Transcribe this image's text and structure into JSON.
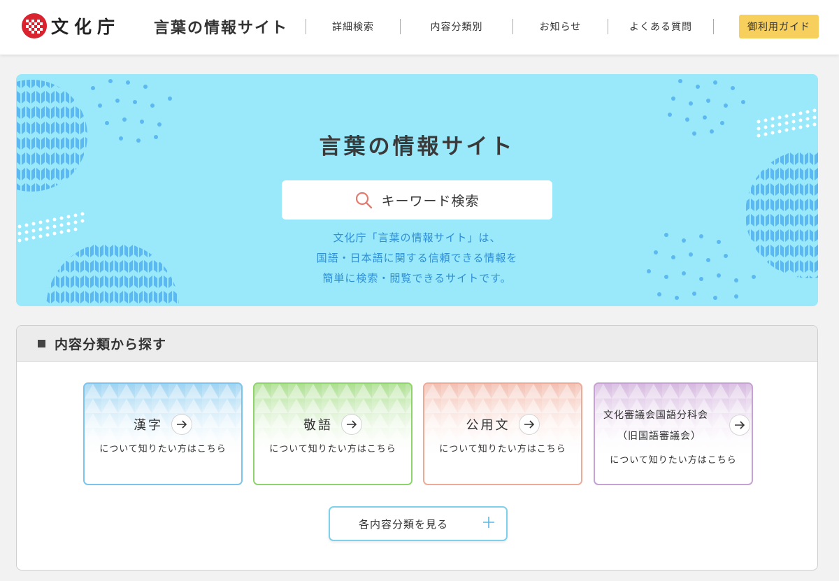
{
  "header": {
    "logo_text": "文化庁",
    "site_title": "言葉の情報サイト",
    "nav": [
      {
        "label": "詳細検索",
        "icon": null
      },
      {
        "label": "内容分類別",
        "icon": null
      },
      {
        "label": "お知らせ",
        "icon": null
      },
      {
        "label": "よくある質問",
        "icon": null
      }
    ],
    "guide_label": "御利用ガイド",
    "guide_color": "#f6cf5c"
  },
  "hero": {
    "title": "言葉の情報サイト",
    "search_placeholder": "キーワード検索",
    "search_icon": "search-icon",
    "description": [
      "文化庁「言葉の情報サイト」は、",
      "国語・日本語に関する信頼できる情報を",
      "簡単に検索・閲覧できるサイトです。"
    ],
    "background_color": "#99e9fb",
    "accent_color": "#2f8fd6"
  },
  "categories": {
    "section_title": "内容分類から探す",
    "items": [
      {
        "name": "漢字",
        "sub": "について知りたい方はこちら",
        "color": "#7cc4ec"
      },
      {
        "name": "敬語",
        "sub": "について知りたい方はこちら",
        "color": "#8fd46a"
      },
      {
        "name": "公用文",
        "sub": "について知りたい方はこちら",
        "color": "#eeaa98"
      },
      {
        "name": "文化審議会国語分科会",
        "name2": "（旧国語審議会）",
        "sub": "について知りたい方はこちら",
        "color": "#c7a0d4"
      }
    ],
    "all_label": "各内容分類を見る",
    "all_icon": "plus-icon"
  }
}
